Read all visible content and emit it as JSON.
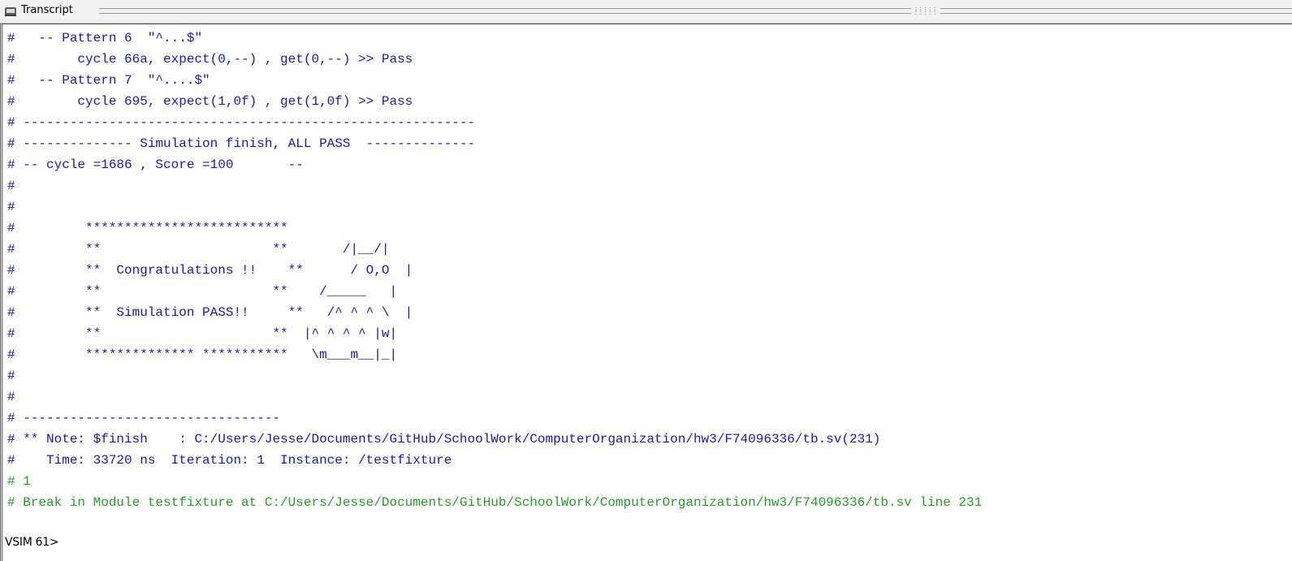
{
  "window": {
    "title": "Transcript",
    "title_icon": "transcript-icon"
  },
  "transcript": {
    "lines": [
      {
        "text": "#   -- Pattern 6  \"^...$\"",
        "color": "#1a1aa8"
      },
      {
        "text": "#        cycle 66a, expect(0,--) , get(0,--) >> Pass",
        "color": "#1a1aa8"
      },
      {
        "text": "#   -- Pattern 7  \"^....$\"",
        "color": "#1a1aa8"
      },
      {
        "text": "#        cycle 695, expect(1,0f) , get(1,0f) >> Pass",
        "color": "#1a1aa8"
      },
      {
        "text": "# ----------------------------------------------------------",
        "color": "#1a1aa8"
      },
      {
        "text": "# -------------- Simulation finish, ALL PASS  --------------",
        "color": "#1a1aa8"
      },
      {
        "text": "# -- cycle =1686 , Score =100       --",
        "color": "#1a1aa8"
      },
      {
        "text": "#",
        "color": "#1a1aa8"
      },
      {
        "text": "#",
        "color": "#1a1aa8"
      },
      {
        "text": "#         **************************",
        "color": "#1a1aa8"
      },
      {
        "text": "#         **                      **       /|__/|",
        "color": "#1a1aa8"
      },
      {
        "text": "#         **  Congratulations !!    **      / O,O  |",
        "color": "#1a1aa8"
      },
      {
        "text": "#         **                      **    /_____   |",
        "color": "#1a1aa8"
      },
      {
        "text": "#         **  Simulation PASS!!     **   /^ ^ ^ \\  |",
        "color": "#1a1aa8"
      },
      {
        "text": "#         **                      **  |^ ^ ^ ^ |w|",
        "color": "#1a1aa8"
      },
      {
        "text": "#         ************** ***********   \\m___m__|_|",
        "color": "#1a1aa8"
      },
      {
        "text": "#",
        "color": "#1a1aa8"
      },
      {
        "text": "#",
        "color": "#1a1aa8"
      },
      {
        "text": "# ---------------------------------",
        "color": "#1a1aa8"
      },
      {
        "text": "# ** Note: $finish    : C:/Users/Jesse/Documents/GitHub/SchoolWork/ComputerOrganization/hw3/F74096336/tb.sv(231)",
        "color": "#1a1aa8"
      },
      {
        "text": "#    Time: 33720 ns  Iteration: 1  Instance: /testfixture",
        "color": "#1a1aa8"
      },
      {
        "text": "# 1",
        "color": "#2a9a2a"
      },
      {
        "text": "# Break in Module testfixture at C:/Users/Jesse/Documents/GitHub/SchoolWork/ComputerOrganization/hw3/F74096336/tb.sv line 231",
        "color": "#2a9a2a"
      }
    ],
    "prompt": "VSIM 61>"
  }
}
